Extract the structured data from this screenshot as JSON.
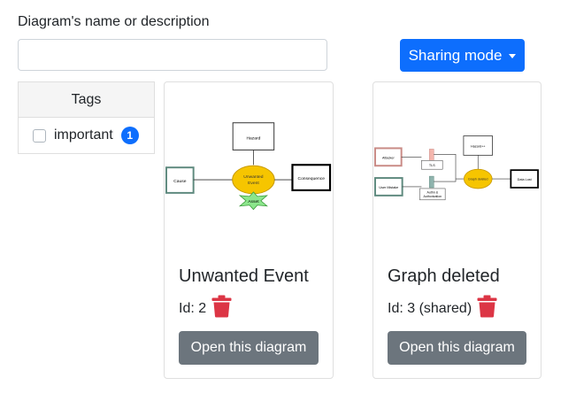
{
  "form": {
    "name_label": "Diagram's name or description",
    "name_value": "",
    "name_placeholder": ""
  },
  "sharing": {
    "label": "Sharing mode",
    "icon": "caret-down-icon"
  },
  "tags": {
    "header": "Tags",
    "items": [
      {
        "label": "important",
        "count": "1",
        "checked": false
      }
    ]
  },
  "cards": [
    {
      "title": "Unwanted Event",
      "id_text": "Id: 2",
      "open_label": "Open this diagram",
      "thumbnail": {
        "hazard": "Hazard",
        "cause": "Cause",
        "event_line1": "Unwanted",
        "event_line2": "Event",
        "consequence": "Consequence",
        "asset": "Asset"
      }
    },
    {
      "title": "Graph deleted",
      "id_text": "Id: 3 (shared)",
      "open_label": "Open this diagram",
      "thumbnail": {
        "attacker": "Attacker",
        "user_mistake": "User Mistake",
        "tls": "TLS",
        "auth_line1": "Authn &",
        "auth_line2": "Authorization",
        "hazard": "Hazard++",
        "event": "Graph deleted",
        "consequence": "Data Lost"
      }
    }
  ],
  "colors": {
    "primary": "#0d6efd",
    "secondary": "#6c757d",
    "danger": "#dc3545",
    "event_fill": "#f6c500",
    "asset_fill": "#8ce68c"
  }
}
